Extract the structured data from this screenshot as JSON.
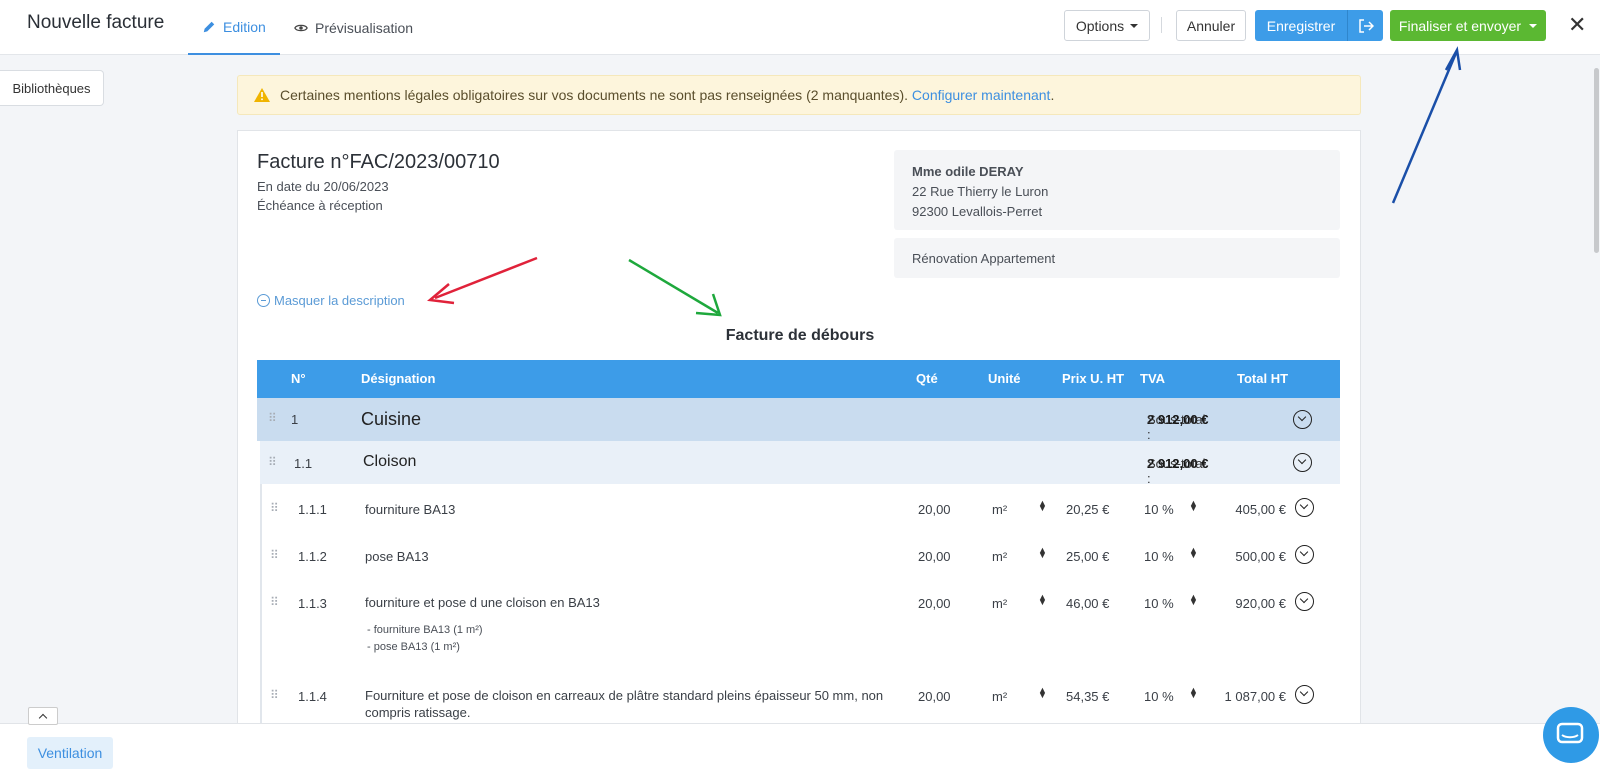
{
  "header": {
    "title": "Nouvelle facture",
    "tabs": [
      {
        "label": "Edition",
        "active": true
      },
      {
        "label": "Prévisualisation",
        "active": false
      }
    ],
    "options_label": "Options",
    "cancel_label": "Annuler",
    "save_label": "Enregistrer",
    "finalize_label": "Finaliser et envoyer",
    "close_glyph": "✕"
  },
  "sidebar": {
    "library_label": "Bibliothèques"
  },
  "alert": {
    "text": "Certaines mentions légales obligatoires sur vos documents ne sont pas renseignées (2 manquantes).",
    "link": "Configurer maintenant",
    "trailing": "."
  },
  "invoice": {
    "title": "Facture n°FAC/2023/00710",
    "date": "En date du 20/06/2023",
    "due": "Échéance à réception",
    "hide_description": "Masquer la description",
    "heading": "Facture de débours"
  },
  "client": {
    "name": "Mme odile DERAY",
    "address1": "22 Rue Thierry le Luron",
    "address2": "92300 Levallois-Perret",
    "project": "Rénovation Appartement"
  },
  "table": {
    "headers": {
      "num": "N°",
      "designation": "Désignation",
      "qty": "Qté",
      "unit": "Unité",
      "price": "Prix U. HT",
      "vat": "TVA",
      "total": "Total HT"
    },
    "section": {
      "num": "1",
      "label": "Cuisine",
      "subtotal_label": "Sous-total : ",
      "subtotal": "2 912,00 €"
    },
    "subsection": {
      "num": "1.1",
      "label": "Cloison",
      "subtotal_label": "Sous-total : ",
      "subtotal": "2 912,00 €"
    },
    "items": [
      {
        "num": "1.1.1",
        "designation": "fourniture BA13",
        "qty": "20,00",
        "unit": "m²",
        "price": "20,25 €",
        "vat": "10 %",
        "total": "405,00 €"
      },
      {
        "num": "1.1.2",
        "designation": "pose BA13",
        "qty": "20,00",
        "unit": "m²",
        "price": "25,00 €",
        "vat": "10 %",
        "total": "500,00 €"
      },
      {
        "num": "1.1.3",
        "designation": "fourniture et pose d une cloison en BA13",
        "qty": "20,00",
        "unit": "m²",
        "price": "46,00 €",
        "vat": "10 %",
        "total": "920,00 €",
        "sub1": "- fourniture BA13 (1 m²)",
        "sub2": "- pose BA13 (1 m²)"
      },
      {
        "num": "1.1.4",
        "designation": "Fourniture et pose de cloison en carreaux de plâtre standard pleins épaisseur 50 mm, non",
        "designation2": "compris ratissage.",
        "qty": "20,00",
        "unit": "m²",
        "price": "54,35 €",
        "vat": "10 %",
        "total": "1 087,00 €"
      }
    ]
  },
  "footer": {
    "ventilation_label": "Ventilation"
  },
  "colors": {
    "primary": "#3d9ce8",
    "success": "#5bb832",
    "warning_bg": "#fdf5dc",
    "arrow_red": "#e0223a",
    "arrow_green": "#1ea83c",
    "arrow_blue": "#1a4fa8"
  }
}
